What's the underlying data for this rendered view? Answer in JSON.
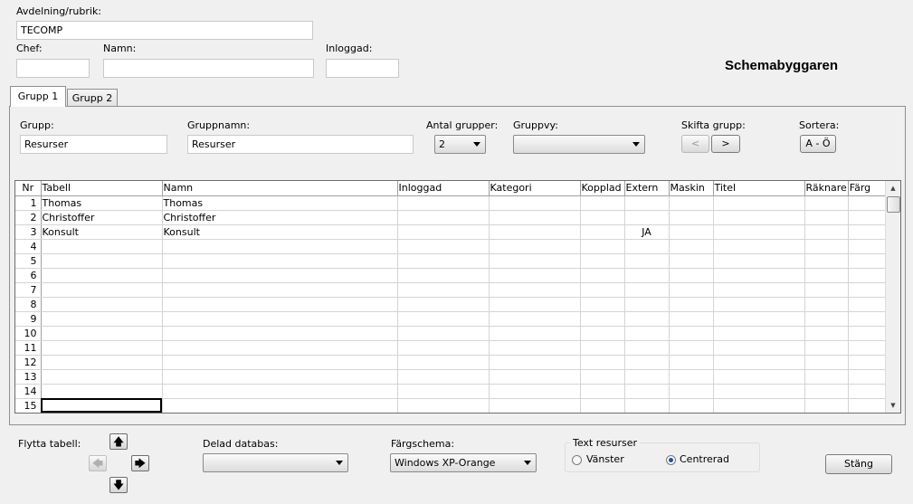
{
  "header": {
    "avdelning_label": "Avdelning/rubrik:",
    "avdelning_value": "TECOMP",
    "chef_label": "Chef:",
    "chef_value": "",
    "namn_label": "Namn:",
    "namn_value": "",
    "inloggad_label": "Inloggad:",
    "inloggad_value": "",
    "app_title": "Schemabyggaren"
  },
  "tabs": [
    {
      "label": "Grupp 1",
      "active": true
    },
    {
      "label": "Grupp 2",
      "active": false
    }
  ],
  "group": {
    "grupp_label": "Grupp:",
    "grupp_value": "Resurser",
    "gruppnamn_label": "Gruppnamn:",
    "gruppnamn_value": "Resurser",
    "antal_label": "Antal grupper:",
    "antal_value": "2",
    "gruppvy_label": "Gruppvy:",
    "gruppvy_value": "",
    "skifta_label": "Skifta grupp:",
    "prev_glyph": "<",
    "next_glyph": ">",
    "sortera_label": "Sortera:",
    "sortera_button": "A - Ö"
  },
  "table": {
    "columns": [
      "Nr",
      "Tabell",
      "Namn",
      "Inloggad",
      "Kategori",
      "Kopplad",
      "Extern",
      "Maskin",
      "Titel",
      "Räknare",
      "Färg"
    ],
    "rows": [
      {
        "nr": "1",
        "tabell": "Thomas",
        "namn": "Thomas",
        "extern": ""
      },
      {
        "nr": "2",
        "tabell": "Christoffer",
        "namn": "Christoffer",
        "extern": ""
      },
      {
        "nr": "3",
        "tabell": "Konsult",
        "namn": "Konsult",
        "extern": "JA"
      },
      {
        "nr": "4",
        "tabell": "",
        "namn": "",
        "extern": ""
      },
      {
        "nr": "5",
        "tabell": "",
        "namn": "",
        "extern": ""
      },
      {
        "nr": "6",
        "tabell": "",
        "namn": "",
        "extern": ""
      },
      {
        "nr": "7",
        "tabell": "",
        "namn": "",
        "extern": ""
      },
      {
        "nr": "8",
        "tabell": "",
        "namn": "",
        "extern": ""
      },
      {
        "nr": "9",
        "tabell": "",
        "namn": "",
        "extern": ""
      },
      {
        "nr": "10",
        "tabell": "",
        "namn": "",
        "extern": ""
      },
      {
        "nr": "11",
        "tabell": "",
        "namn": "",
        "extern": ""
      },
      {
        "nr": "12",
        "tabell": "",
        "namn": "",
        "extern": ""
      },
      {
        "nr": "13",
        "tabell": "",
        "namn": "",
        "extern": ""
      },
      {
        "nr": "14",
        "tabell": "",
        "namn": "",
        "extern": ""
      },
      {
        "nr": "15",
        "tabell": "",
        "namn": "",
        "extern": ""
      }
    ]
  },
  "footer": {
    "flytta_label": "Flytta tabell:",
    "arrow_up": "🡅",
    "arrow_left": "🡄",
    "arrow_right": "🡆",
    "arrow_down": "🡇",
    "delad_label": "Delad databas:",
    "delad_value": "",
    "fargschema_label": "Färgschema:",
    "fargschema_value": "Windows XP-Orange",
    "text_resurser_label": "Text resurser",
    "vanster_label": "Vänster",
    "centrerad_label": "Centrerad",
    "selected_alignment": "Centrerad",
    "stang_button": "Stäng"
  },
  "colors": {
    "background": "#f0f0f0",
    "grid_lines": "#d4d4d4",
    "radio_selected": "#1f4fa8"
  },
  "icons": {
    "scroll_up": "▲",
    "scroll_down": "▼"
  }
}
